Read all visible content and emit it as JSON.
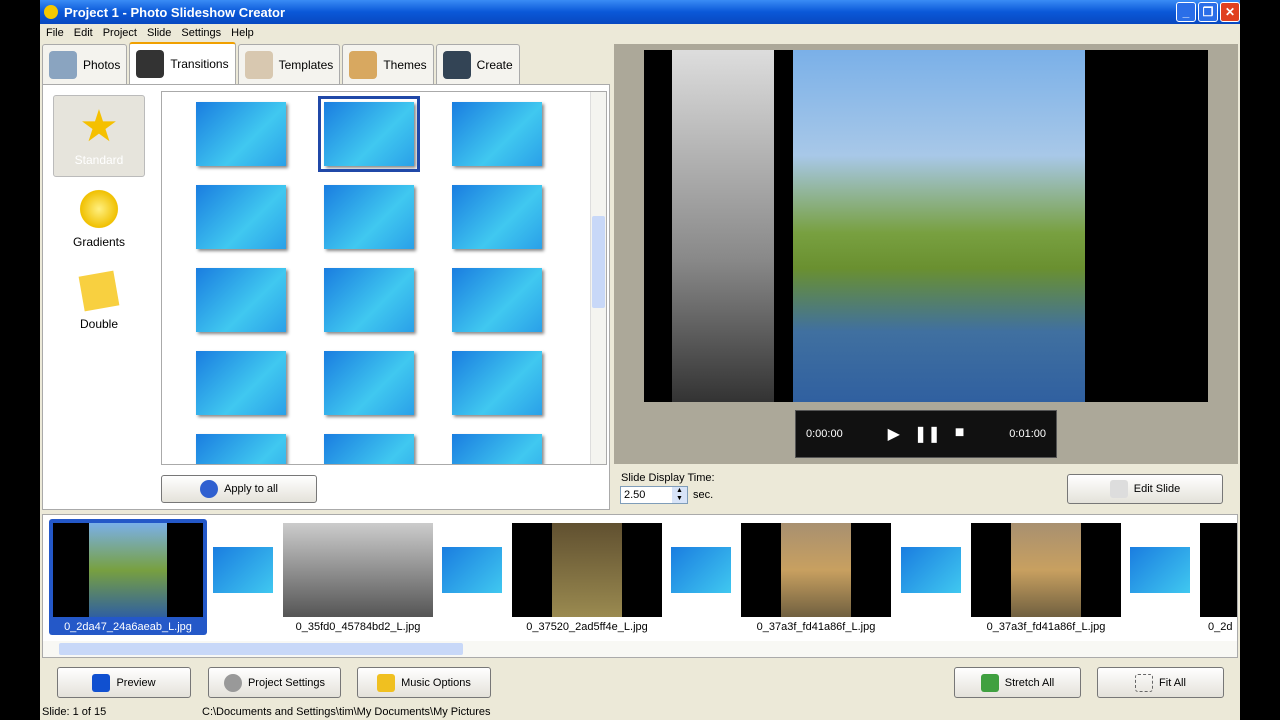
{
  "window": {
    "title": "Project 1 - Photo Slideshow Creator",
    "icon": "smiley-icon"
  },
  "menu": [
    "File",
    "Edit",
    "Project",
    "Slide",
    "Settings",
    "Help"
  ],
  "tabs": [
    {
      "label": "Photos",
      "icon": "camera-icon"
    },
    {
      "label": "Transitions",
      "icon": "magic-hat-icon",
      "active": true
    },
    {
      "label": "Templates",
      "icon": "notebook-icon"
    },
    {
      "label": "Themes",
      "icon": "palette-icon"
    },
    {
      "label": "Create",
      "icon": "camcorder-icon"
    }
  ],
  "categories": [
    {
      "label": "Standard",
      "active": true
    },
    {
      "label": "Gradients"
    },
    {
      "label": "Double"
    }
  ],
  "apply_all": "Apply to all",
  "player": {
    "current": "0:00:00",
    "total": "0:01:00"
  },
  "slide_time": {
    "label": "Slide Display Time:",
    "value": "2.50",
    "unit": "sec."
  },
  "edit_slide": "Edit Slide",
  "slides": [
    "0_2da47_24a6aeab_L.jpg",
    "0_35fd0_45784bd2_L.jpg",
    "0_37520_2ad5ff4e_L.jpg",
    "0_37a3f_fd41a86f_L.jpg",
    "0_37a3f_fd41a86f_L.jpg",
    "0_2d"
  ],
  "buttons": {
    "preview": "Preview",
    "project_settings": "Project Settings",
    "music_options": "Music Options",
    "stretch_all": "Stretch All",
    "fit_all": "Fit All"
  },
  "status": {
    "slide": "Slide: 1 of 15",
    "path": "C:\\Documents and Settings\\tim\\My Documents\\My Pictures"
  }
}
